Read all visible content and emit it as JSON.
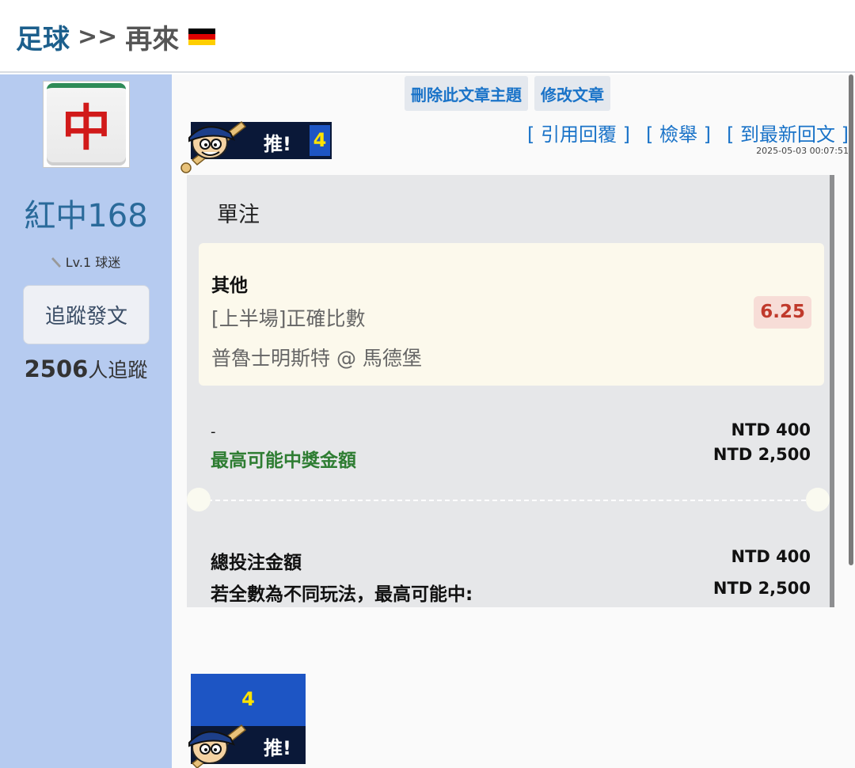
{
  "header": {
    "crumb": "足球",
    "separator": ">>",
    "title": "再來",
    "flag": "germany-flag-icon"
  },
  "sidebar": {
    "avatar": "red-dragon-mahjong-tile",
    "avatar_char": "中",
    "user_name": "紅中168",
    "level": "Lv.1 球迷",
    "follow_button": "追蹤發文",
    "follower_count": "2506",
    "follower_label": "人追蹤"
  },
  "actions": {
    "delete_topic": "刪除此文章主題",
    "edit_post": "修改文章"
  },
  "links": {
    "quote_reply": "[ 引用回覆 ]",
    "report": "[ 檢舉 ]",
    "latest_reply": "[ 到最新回文 ]"
  },
  "timestamp": "2025-05-03 00:07:51",
  "push": {
    "label": "推!",
    "count": "4"
  },
  "ticket": {
    "type": "單注",
    "bet": {
      "category": "其他",
      "market": "[上半場]正確比數",
      "match": "普魯士明斯特 @ 馬德堡",
      "odds": "6.25"
    },
    "stake_dash": "-",
    "stake": "NTD 400",
    "max_payout_label": "最高可能中獎金額",
    "max_payout": "NTD 2,500",
    "total_label": "總投注金額",
    "total": "NTD 400",
    "all_diff_label": "若全數為不同玩法，最高可能中:",
    "all_diff": "NTD 2,500"
  },
  "colors": {
    "sidebar_bg": "#b6cbf0",
    "link_blue": "#1a73c8",
    "payout_green": "#2e7d32",
    "odds_red": "#c0392b",
    "push_yellow": "#ffe300"
  }
}
